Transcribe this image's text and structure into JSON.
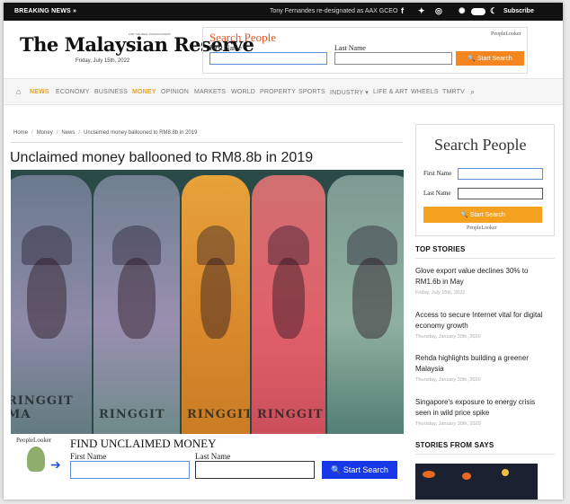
{
  "topbar": {
    "breaking": "BREAKING NEWS »",
    "ticker": "Tony Fernandes re-designated as AAX GCEO",
    "subscribe": "Subscribe"
  },
  "header": {
    "logo": "The Malaysian Reserve",
    "tagline": "FOR THE REAL STAKEHOLDERS",
    "date": "Friday, July 15th, 2022"
  },
  "header_search": {
    "title": "Search People",
    "brand": "PeopleLooker",
    "first_name_label": "First Name",
    "last_name_label": "Last Name",
    "button": "Start Search"
  },
  "nav": {
    "items": [
      "NEWS",
      "ECONOMY",
      "BUSINESS",
      "MONEY",
      "OPINION",
      "MARKETS",
      "WORLD",
      "PROPERTY",
      "SPORTS",
      "INDUSTRY ▾",
      "LIFE & ART",
      "WHEELS",
      "TMRTV"
    ]
  },
  "breadcrumb": {
    "items": [
      "Home",
      "Money",
      "News",
      "Unclaimed money ballooned to RM8.8b in 2019"
    ]
  },
  "article": {
    "title": "Unclaimed money ballooned to RM8.8b in 2019",
    "note_texts": [
      "RINGGIT MA",
      "RINGGIT",
      "RINGGIT",
      "RINGGIT"
    ]
  },
  "find_money": {
    "brand": "PeopleLooker",
    "title": "FIND UNCLAIMED MONEY",
    "first_name_label": "First Name",
    "last_name_label": "Last Name",
    "button": "Start Search"
  },
  "sidebar_search": {
    "title": "Search People",
    "first_name_label": "First Name",
    "last_name_label": "Last Name",
    "button": "Start Search",
    "brand": "PeopleLooker"
  },
  "top_stories": {
    "heading": "TOP STORIES",
    "items": [
      {
        "headline": "Glove export value declines 30% to RM1.6b in May",
        "date": "Friday, July 15th, 2022"
      },
      {
        "headline": "Access to secure Internet vital for digital economy growth",
        "date": "Thursday, January 30th, 2020"
      },
      {
        "headline": "Rehda highlights building a greener Malaysia",
        "date": "Thursday, January 30th, 2020"
      },
      {
        "headline": "Singapore's exposure to energy crisis seen in wild price spike",
        "date": "Thursday, January 30th, 2020"
      }
    ]
  },
  "says": {
    "heading": "STORIES FROM SAYS"
  },
  "colors": {
    "accent": "#e8a21a",
    "search_orange": "#f4851f",
    "find_blue": "#1638e6"
  }
}
